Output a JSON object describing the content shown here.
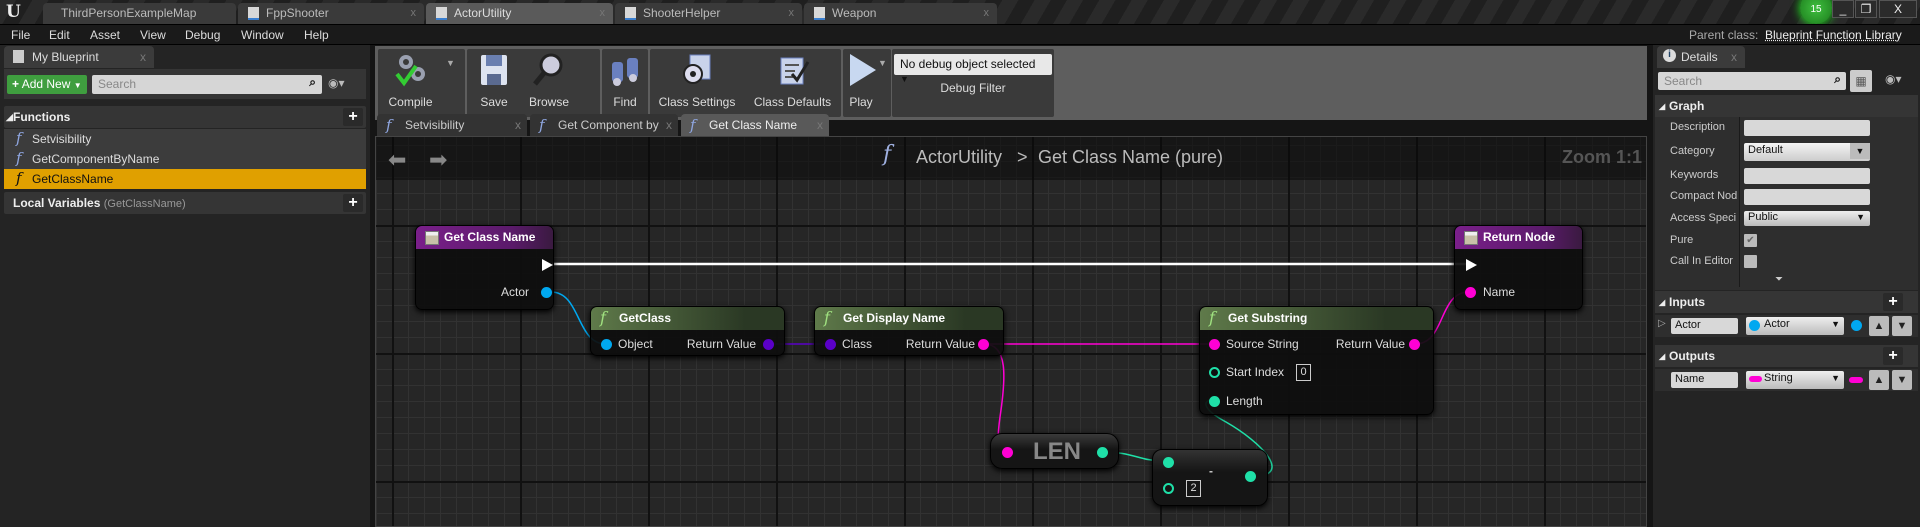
{
  "window": {
    "tabs": [
      {
        "label": "ThirdPersonExampleMap",
        "active": false
      },
      {
        "label": "FppShooter",
        "active": false
      },
      {
        "label": "ActorUtility",
        "active": true
      },
      {
        "label": "ShooterHelper",
        "active": false
      },
      {
        "label": "Weapon",
        "active": false
      }
    ],
    "notification_count": "15",
    "minimize": "_",
    "restore": "❐",
    "close": "X"
  },
  "menu": {
    "items": [
      "File",
      "Edit",
      "Asset",
      "View",
      "Debug",
      "Window",
      "Help"
    ],
    "parent_class_label": "Parent class:",
    "parent_class_value": "Blueprint Function Library"
  },
  "my_blueprint": {
    "tab_label": "My Blueprint",
    "add_new_label": "Add New",
    "search_placeholder": "Search",
    "functions_header": "Functions",
    "functions": [
      {
        "label": "Setvisibility",
        "selected": false
      },
      {
        "label": "GetComponentByName",
        "selected": false
      },
      {
        "label": "GetClassName",
        "selected": true
      }
    ],
    "local_vars_header": "Local Variables",
    "local_vars_context": "(GetClassName)"
  },
  "toolbar": {
    "compile": "Compile",
    "save": "Save",
    "browse": "Browse",
    "find": "Find",
    "class_settings": "Class Settings",
    "class_defaults": "Class Defaults",
    "play": "Play",
    "debug_object": "No debug object selected",
    "debug_filter": "Debug Filter"
  },
  "graph_tabs": [
    {
      "label": "Setvisibility",
      "active": false
    },
    {
      "label": "Get Component by",
      "active": false
    },
    {
      "label": "Get Class Name",
      "active": true
    }
  ],
  "graph": {
    "breadcrumb_root": "ActorUtility",
    "breadcrumb_sep": ">",
    "breadcrumb_current": "Get Class Name (pure)",
    "zoom": "Zoom 1:1",
    "nodes": {
      "entry": {
        "title": "Get Class Name",
        "pin_actor": "Actor"
      },
      "get_class": {
        "title": "GetClass",
        "pin_in": "Object",
        "pin_out": "Return Value"
      },
      "display_name": {
        "title": "Get Display Name",
        "pin_in": "Class",
        "pin_out": "Return Value"
      },
      "substring": {
        "title": "Get Substring",
        "pin_source": "Source String",
        "pin_start": "Start Index",
        "start_value": "0",
        "pin_length": "Length",
        "pin_out": "Return Value"
      },
      "return": {
        "title": "Return Node",
        "pin_name": "Name"
      },
      "len": {
        "title": "LEN"
      },
      "subtract": {
        "operator": "-",
        "b_value": "2"
      }
    },
    "colors": {
      "object": "#00a8f0",
      "class": "#5a00c8",
      "string": "#ff00d4",
      "int": "#1fe0a8",
      "exec": "#ffffff"
    }
  },
  "details": {
    "tab_label": "Details",
    "search_placeholder": "Search",
    "graph_header": "Graph",
    "rows": {
      "description": "Description",
      "category": "Category",
      "category_value": "Default",
      "keywords": "Keywords",
      "compact": "Compact Nod",
      "access": "Access Speci",
      "access_value": "Public",
      "pure": "Pure",
      "pure_checked": true,
      "call_in_editor": "Call In Editor",
      "call_in_editor_checked": false
    },
    "inputs_header": "Inputs",
    "inputs": [
      {
        "name": "Actor",
        "type": "Actor"
      }
    ],
    "outputs_header": "Outputs",
    "outputs": [
      {
        "name": "Name",
        "type": "String"
      }
    ]
  }
}
